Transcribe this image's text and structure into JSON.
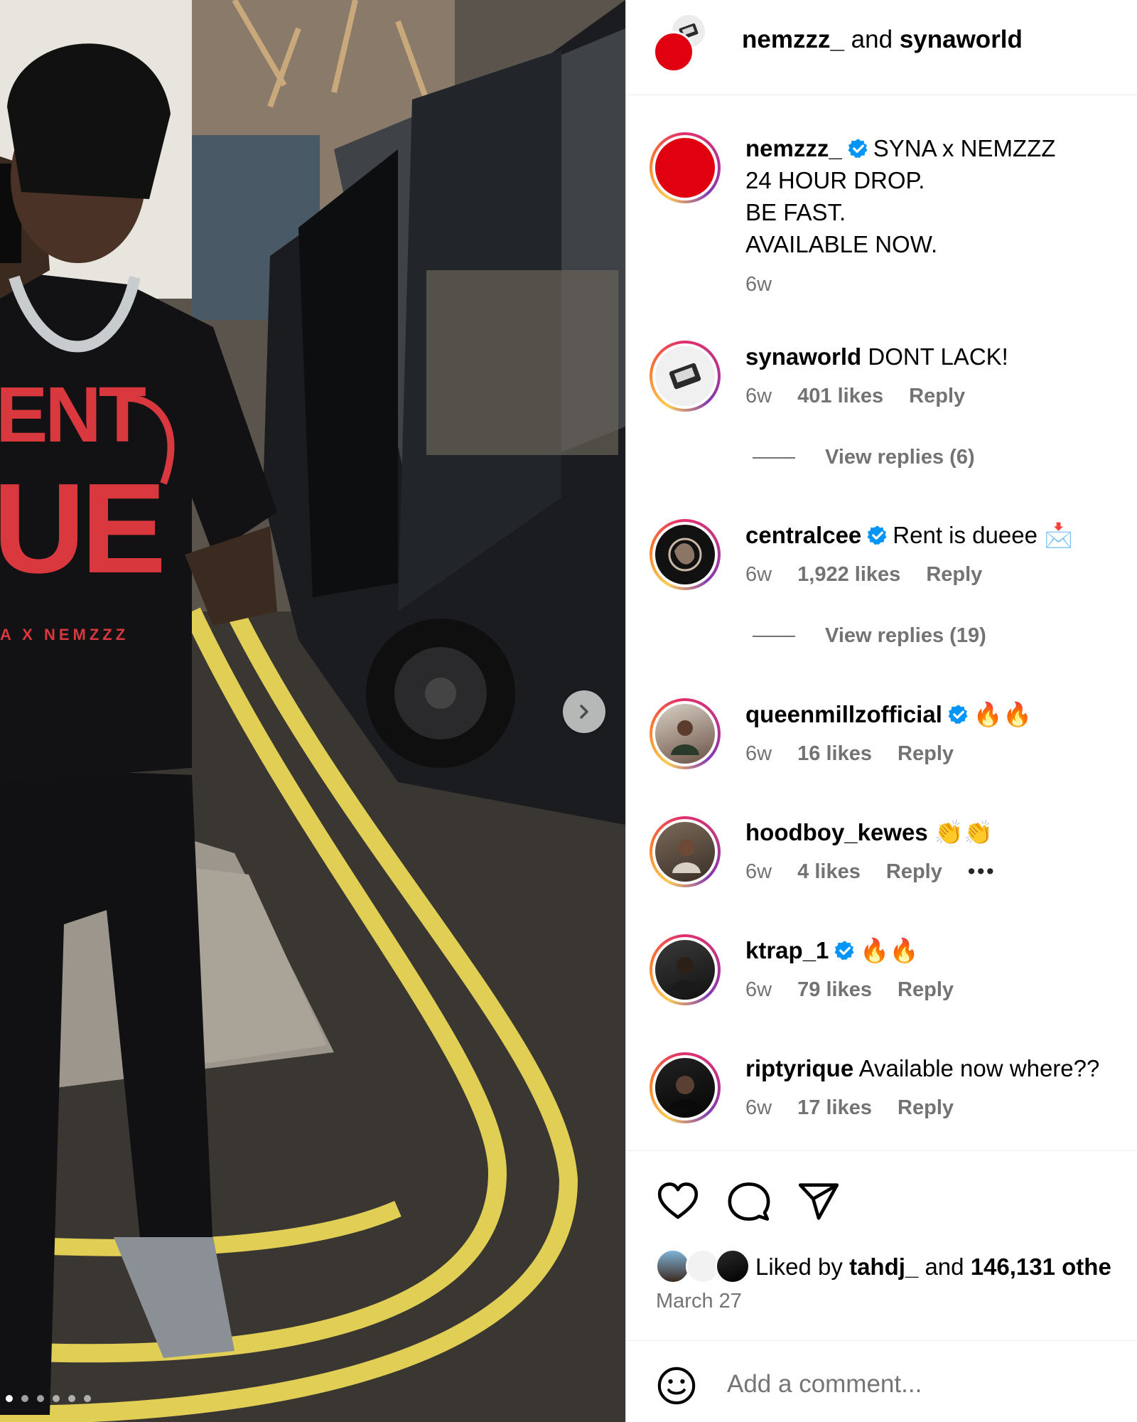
{
  "header": {
    "owner": "nemzzz_",
    "joiner": "and",
    "collaborator": "synaworld"
  },
  "caption": {
    "user": "nemzzz_",
    "verified": true,
    "lines": [
      "SYNA x NEMZZZ",
      "24 HOUR DROP.",
      "BE FAST.",
      "AVAILABLE NOW."
    ],
    "time": "6w"
  },
  "shirt_print": {
    "big_text_1": "ENT",
    "big_text_2": "UE",
    "small_text": "A X NEMZZZ"
  },
  "comments": [
    {
      "user": "synaworld",
      "verified": false,
      "text": "DONT LACK!",
      "time": "6w",
      "likes": "401 likes",
      "reply": "Reply",
      "view_replies": "View replies (6)",
      "avatar": "device-icon"
    },
    {
      "user": "centralcee",
      "verified": true,
      "text": "Rent is dueee 📩",
      "time": "6w",
      "likes": "1,922 likes",
      "reply": "Reply",
      "view_replies": "View replies (19)",
      "avatar": "sketch-icon"
    },
    {
      "user": "queenmillzofficial",
      "verified": true,
      "text": "🔥🔥",
      "time": "6w",
      "likes": "16 likes",
      "reply": "Reply",
      "avatar": "person-photo"
    },
    {
      "user": "hoodboy_kewes",
      "verified": false,
      "text": "👏👏",
      "time": "6w",
      "likes": "4 likes",
      "reply": "Reply",
      "more": "•••",
      "avatar": "person-photo"
    },
    {
      "user": "ktrap_1",
      "verified": true,
      "text": "🔥🔥",
      "time": "6w",
      "likes": "79 likes",
      "reply": "Reply",
      "avatar": "person-photo"
    },
    {
      "user": "riptyrique",
      "verified": false,
      "text": "Available now where??",
      "time": "6w",
      "likes": "17 likes",
      "reply": "Reply",
      "avatar": "person-photo"
    }
  ],
  "actions": {
    "icons": [
      "heart-icon",
      "comment-icon",
      "share-icon"
    ]
  },
  "likes_summary": {
    "prefix": "Liked by",
    "user": "tahdj_",
    "joiner": "and",
    "count": "146,131 othe"
  },
  "date": "March 27",
  "add_comment": {
    "placeholder": "Add a comment..."
  },
  "carousel": {
    "slide_count": 6,
    "active_index": 0
  },
  "colors": {
    "verified_blue": "#0095f6",
    "muted_text": "#737373",
    "brand_red": "#e10010",
    "shirt_print_red": "#d8383e"
  }
}
